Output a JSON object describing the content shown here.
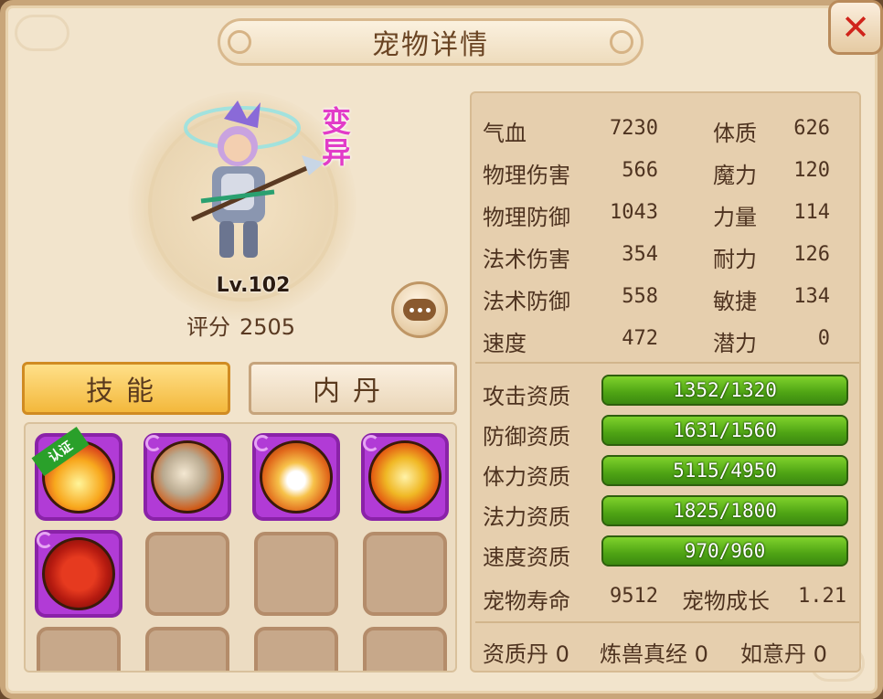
{
  "title": "宠物详情",
  "close_icon": "close-x-icon",
  "pet": {
    "badge": "变异",
    "level": "Lv.102",
    "score_label": "评分",
    "score_value": "2505"
  },
  "tabs": [
    {
      "label": "技能",
      "active": true
    },
    {
      "label": "内丹",
      "active": false
    }
  ],
  "skills": {
    "cert_label": "认证",
    "slots": [
      {
        "type": "skill",
        "icon": "fire-skill-icon",
        "certified": true
      },
      {
        "type": "skill",
        "icon": "flame-shield-skill-icon"
      },
      {
        "type": "skill",
        "icon": "rabbit-skill-icon"
      },
      {
        "type": "skill",
        "icon": "golden-shield-skill-icon"
      },
      {
        "type": "skill",
        "icon": "angry-spirit-skill-icon"
      },
      {
        "type": "empty"
      },
      {
        "type": "empty"
      },
      {
        "type": "empty"
      },
      {
        "type": "empty"
      },
      {
        "type": "empty"
      },
      {
        "type": "empty"
      },
      {
        "type": "empty"
      }
    ]
  },
  "stats": {
    "left": [
      {
        "label": "气血",
        "value": "7230"
      },
      {
        "label": "物理伤害",
        "value": "566"
      },
      {
        "label": "物理防御",
        "value": "1043"
      },
      {
        "label": "法术伤害",
        "value": "354"
      },
      {
        "label": "法术防御",
        "value": "558"
      },
      {
        "label": "速度",
        "value": "472"
      }
    ],
    "right": [
      {
        "label": "体质",
        "value": "626"
      },
      {
        "label": "魔力",
        "value": "120"
      },
      {
        "label": "力量",
        "value": "114"
      },
      {
        "label": "耐力",
        "value": "126"
      },
      {
        "label": "敏捷",
        "value": "134"
      },
      {
        "label": "潜力",
        "value": "0"
      }
    ]
  },
  "aptitudes": [
    {
      "label": "攻击资质",
      "text": "1352/1320",
      "fill_fraction": 1.0
    },
    {
      "label": "防御资质",
      "text": "1631/1560",
      "fill_fraction": 1.0
    },
    {
      "label": "体力资质",
      "text": "5115/4950",
      "fill_fraction": 1.0
    },
    {
      "label": "法力资质",
      "text": "1825/1800",
      "fill_fraction": 1.0
    },
    {
      "label": "速度资质",
      "text": "970/960",
      "fill_fraction": 1.0
    }
  ],
  "life": {
    "label": "宠物寿命",
    "value": "9512"
  },
  "growth": {
    "label": "宠物成长",
    "value": "1.21"
  },
  "items": [
    {
      "label": "资质丹",
      "value": "0"
    },
    {
      "label": "炼兽真经",
      "value": "0"
    },
    {
      "label": "如意丹",
      "value": "0"
    }
  ],
  "colors": {
    "bar_green": "#4ea314",
    "badge_pink": "#e23cc8",
    "close_red": "#d0241b",
    "skill_purple": "#b13bd6"
  }
}
